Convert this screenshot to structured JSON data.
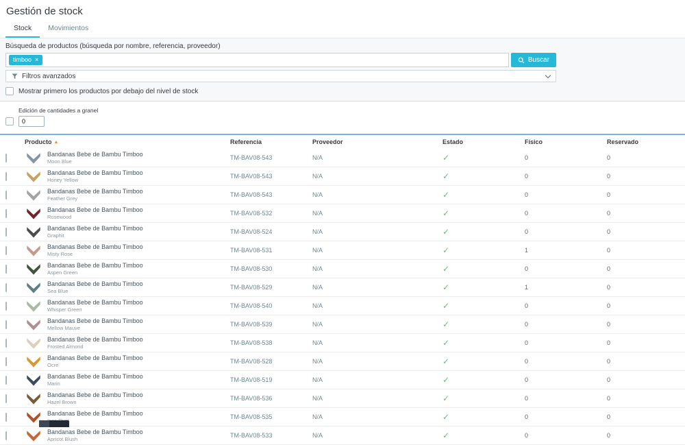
{
  "page": {
    "title": "Gestión de stock"
  },
  "tabs": [
    {
      "label": "Stock",
      "active": true
    },
    {
      "label": "Movimientos",
      "active": false
    }
  ],
  "search": {
    "label": "Búsqueda de productos (búsqueda por nombre, referencia, proveedor)",
    "tag": "timboo",
    "tag_close": "×",
    "button": "Buscar",
    "filters_label": "Filtros avanzados",
    "low_stock_checkbox": "Mostrar primero los productos por debajo del nivel de stock"
  },
  "bulk": {
    "label": "Edición de cantidades a granel",
    "value": "0"
  },
  "colors": {
    "accent": "#25b9d7",
    "status_ok": "#70b580",
    "sort_arrow": "#ef8743",
    "table_top_border": "#79b2e0"
  },
  "table": {
    "columns": [
      "Producto",
      "Referencia",
      "Proveedor",
      "Estado",
      "Físico",
      "Reservado"
    ],
    "sort_glyph": "▲",
    "rows": [
      {
        "name": "Bandanas Bebe de Bambu Timboo",
        "variant": "Moon Blue",
        "color": "#8595a8",
        "reference": "TM-BAV08-543",
        "supplier": "N/A",
        "status": "✓",
        "physical": "0",
        "reserved": "0"
      },
      {
        "name": "Bandanas Bebe de Bambu Timboo",
        "variant": "Honey Yellow",
        "color": "#c8a264",
        "reference": "TM-BAV08-543",
        "supplier": "N/A",
        "status": "✓",
        "physical": "0",
        "reserved": "0"
      },
      {
        "name": "Bandanas Bebe de Bambu Timboo",
        "variant": "Feather Grey",
        "color": "#a3a3a1",
        "reference": "TM-BAV08-543",
        "supplier": "N/A",
        "status": "✓",
        "physical": "0",
        "reserved": "0"
      },
      {
        "name": "Bandanas Bebe de Bambu Timboo",
        "variant": "Rosewood",
        "color": "#71262e",
        "reference": "TM-BAV08-532",
        "supplier": "N/A",
        "status": "✓",
        "physical": "0",
        "reserved": "0"
      },
      {
        "name": "Bandanas Bebe de Bambu Timboo",
        "variant": "Graphit",
        "color": "#4d4d4f",
        "reference": "TM-BAV08-524",
        "supplier": "N/A",
        "status": "✓",
        "physical": "0",
        "reserved": "0"
      },
      {
        "name": "Bandanas Bebe de Bambu Timboo",
        "variant": "Misty Rose",
        "color": "#c49a90",
        "reference": "TM-BAV08-531",
        "supplier": "N/A",
        "status": "✓",
        "physical": "1",
        "reserved": "0"
      },
      {
        "name": "Bandanas Bebe de Bambu Timboo",
        "variant": "Aspen Green",
        "color": "#42553f",
        "reference": "TM-BAV08-530",
        "supplier": "N/A",
        "status": "✓",
        "physical": "0",
        "reserved": "0"
      },
      {
        "name": "Bandanas Bebe de Bambu Timboo",
        "variant": "Sea Blue",
        "color": "#5e7f86",
        "reference": "TM-BAV08-529",
        "supplier": "N/A",
        "status": "✓",
        "physical": "1",
        "reserved": "0"
      },
      {
        "name": "Bandanas Bebe de Bambu Timboo",
        "variant": "Whisper Green",
        "color": "#aab8a4",
        "reference": "TM-BAV08-540",
        "supplier": "N/A",
        "status": "✓",
        "physical": "0",
        "reserved": "0"
      },
      {
        "name": "Bandanas Bebe de Bambu Timboo",
        "variant": "Mellow Mauve",
        "color": "#af8f94",
        "reference": "TM-BAV08-539",
        "supplier": "N/A",
        "status": "✓",
        "physical": "0",
        "reserved": "0"
      },
      {
        "name": "Bandanas Bebe de Bambu Timboo",
        "variant": "Frosted Almond",
        "color": "#dbd0ba",
        "reference": "TM-BAV08-538",
        "supplier": "N/A",
        "status": "✓",
        "physical": "0",
        "reserved": "0"
      },
      {
        "name": "Bandanas Bebe de Bambu Timboo",
        "variant": "Ocre",
        "color": "#d79a33",
        "reference": "TM-BAV08-528",
        "supplier": "N/A",
        "status": "✓",
        "physical": "0",
        "reserved": "0"
      },
      {
        "name": "Bandanas Bebe de Bambu Timboo",
        "variant": "Marin",
        "color": "#3e4b5e",
        "reference": "TM-BAV08-519",
        "supplier": "N/A",
        "status": "✓",
        "physical": "0",
        "reserved": "0"
      },
      {
        "name": "Bandanas Bebe de Bambu Timboo",
        "variant": "Hazel Brown",
        "color": "#7b5a3c",
        "reference": "TM-BAV08-536",
        "supplier": "N/A",
        "status": "✓",
        "physical": "0",
        "reserved": "0"
      },
      {
        "name": "Bandanas Bebe de Bambu Timboo",
        "variant": "Inca Rust",
        "color": "#b0512c",
        "reference": "TM-BAV08-535",
        "supplier": "N/A",
        "status": "✓",
        "physical": "0",
        "reserved": "0"
      },
      {
        "name": "Bandanas Bebe de Bambu Timboo",
        "variant": "Apricot Blush",
        "color": "#c4673c",
        "reference": "TM-BAV08-533",
        "supplier": "N/A",
        "status": "✓",
        "physical": "0",
        "reserved": "0"
      }
    ]
  }
}
